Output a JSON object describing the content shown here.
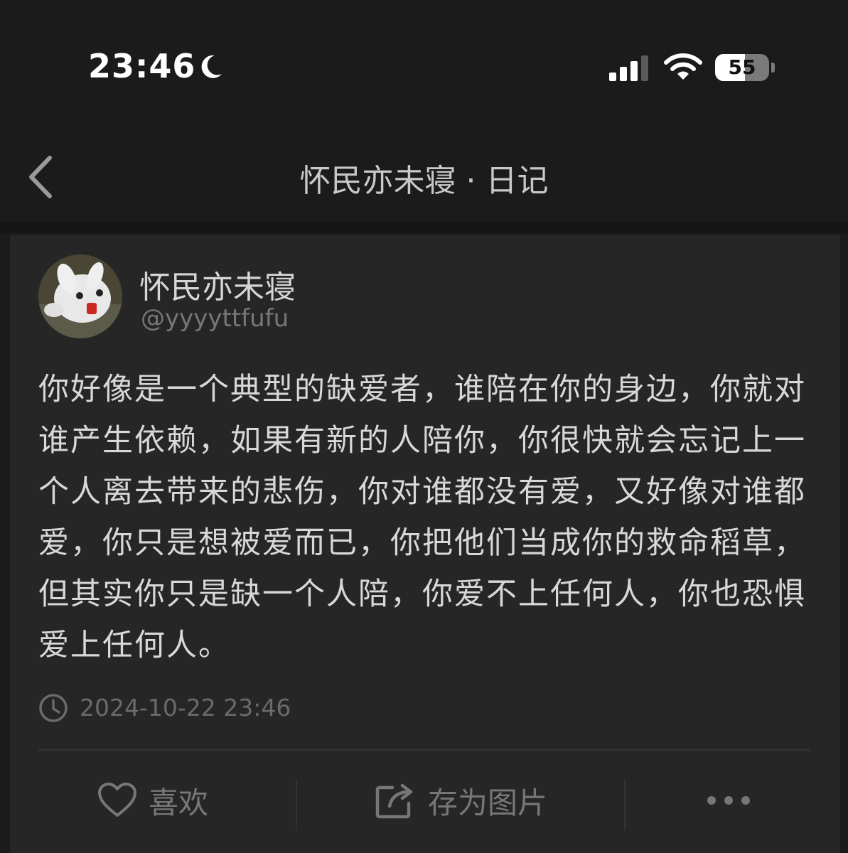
{
  "status_bar": {
    "time": "23:46",
    "battery_level": "55",
    "battery_fraction": 0.55,
    "signal_bars_active": 3,
    "signal_bars_total": 4,
    "icons": [
      "moon-icon",
      "cellular-signal-icon",
      "wifi-icon",
      "battery-icon"
    ]
  },
  "nav": {
    "title": "怀民亦未寝 · 日记",
    "back_icon": "chevron-left-icon"
  },
  "post": {
    "author_name": "怀民亦未寝",
    "author_handle": "@yyyyttfufu",
    "body": "你好像是一个典型的缺爱者，谁陪在你的身边，你就对谁产生依赖，如果有新的人陪你，你很快就会忘记上一个人离去带来的悲伤，你对谁都没有爱，又好像对谁都爱，你只是想被爱而已，你把他们当成你的救命稻草，但其实你只是缺一个人陪，你爱不上任何人，你也恐惧爱上任何人。",
    "timestamp": "2024-10-22 23:46"
  },
  "actions": {
    "like_label": "喜欢",
    "save_image_label": "存为图片",
    "more_icon": "more-dots-icon"
  },
  "colors": {
    "background": "#1b1b1b",
    "card": "#262626",
    "text_primary": "#d8d8d8",
    "text_secondary": "#777777"
  }
}
